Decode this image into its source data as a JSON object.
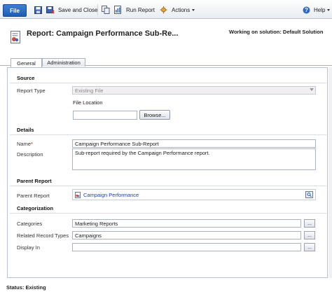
{
  "ribbon": {
    "file_label": "File",
    "save_close_label": "Save and Close",
    "run_report_label": "Run Report",
    "actions_label": "Actions",
    "help_label": "Help"
  },
  "header": {
    "title": "Report: Campaign Performance Sub-Re...",
    "solution_text": "Working on solution: Default Solution"
  },
  "tabs": [
    {
      "label": "General"
    },
    {
      "label": "Administration"
    }
  ],
  "source": {
    "heading": "Source",
    "report_type_label": "Report Type",
    "report_type_value": "Existing File",
    "file_location_label": "File Location",
    "file_location_value": "",
    "browse_label": "Browse..."
  },
  "details": {
    "heading": "Details",
    "name_label": "Name",
    "name_required": "*",
    "name_value": "Campaign Performance Sub-Report",
    "description_label": "Description",
    "description_value": "Sub-report required by the Campaign Performance report."
  },
  "parent": {
    "heading": "Parent Report",
    "parent_label": "Parent Report",
    "parent_value": "Campaign Performance"
  },
  "categorization": {
    "heading": "Categorization",
    "categories_label": "Categories",
    "categories_value": "Marketing Reports",
    "related_label": "Related Record Types",
    "related_value": "Campaigns",
    "display_label": "Display In",
    "display_value": "",
    "ellipsis": "..."
  },
  "status": {
    "text": "Status: Existing"
  }
}
